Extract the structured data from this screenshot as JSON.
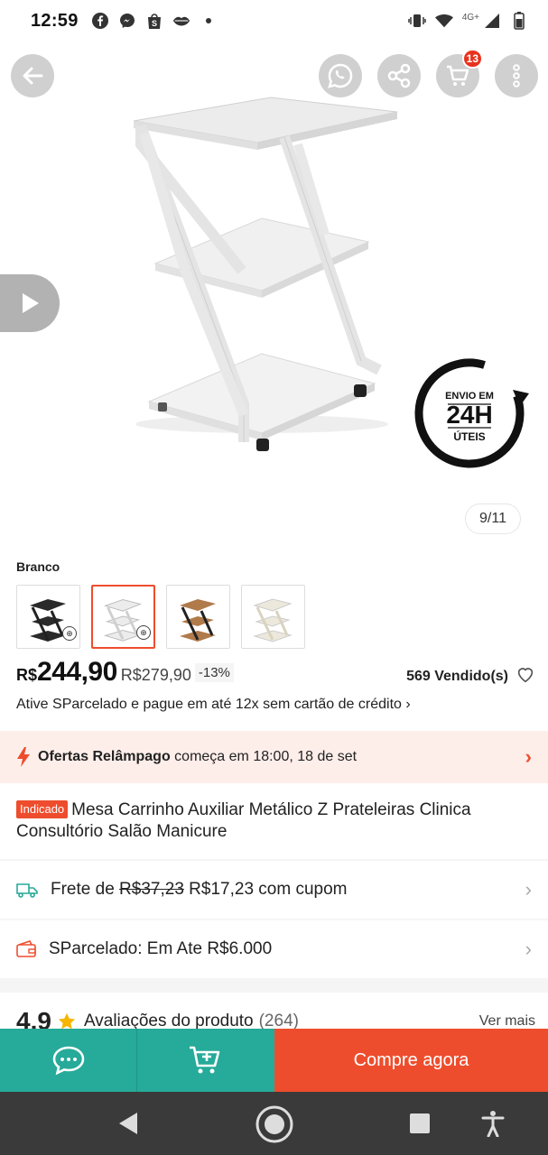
{
  "status_bar": {
    "time": "12:59",
    "network": "4G+",
    "left_icons": [
      "facebook-icon",
      "messenger-icon",
      "shopee-icon",
      "lips-icon",
      "dot-icon"
    ],
    "right_icons": [
      "vibrate-icon",
      "wifi-icon",
      "signal-icon",
      "battery-icon"
    ]
  },
  "header": {
    "cart_count": "13"
  },
  "gallery": {
    "counter": "9/11",
    "badge_top": "ENVIO EM",
    "badge_main": "24H",
    "badge_bottom": "ÚTEIS"
  },
  "variants": {
    "label": "Branco",
    "items": [
      {
        "color": "#222222"
      },
      {
        "color": "#ffffff"
      },
      {
        "color": "#b07a4a"
      },
      {
        "color": "#ece8dc"
      }
    ],
    "selected_index": 1
  },
  "price": {
    "currency": "R$",
    "current": "244,90",
    "original": "R$279,90",
    "discount": "-13%",
    "sold": "569 Vendido(s)"
  },
  "installments": {
    "text": "Ative SParcelado e pague em até 12x sem cartão de crédito ›"
  },
  "flash_sale": {
    "title": "Ofertas Relâmpago",
    "text": "começa em 18:00, 18 de set"
  },
  "product": {
    "tag": "Indicado",
    "title": "Mesa Carrinho Auxiliar Metálico Z Prateleiras Clinica Consultório Salão Manicure"
  },
  "shipping": {
    "label": "Frete de",
    "old_price": "R$37,23",
    "new_price": "R$17,23 com cupom"
  },
  "sparcelado": {
    "text": "SParcelado: Em Ate R$6.000"
  },
  "ratings": {
    "score": "4.9",
    "title": "Avaliações do produto",
    "count": "(264)",
    "see_more": "Ver mais"
  },
  "actions": {
    "buy_now": "Compre agora"
  },
  "colors": {
    "accent": "#ee4d2d",
    "teal": "#26aa99",
    "nav_bg": "#3a3a3a"
  }
}
